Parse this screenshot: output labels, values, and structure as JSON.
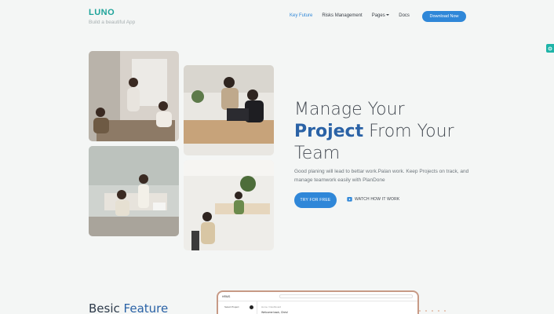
{
  "brand": {
    "name": "LUNO",
    "tagline": "Build a beautiful App"
  },
  "nav": {
    "items": [
      {
        "label": "Key Future",
        "active": true
      },
      {
        "label": "Risks Management",
        "active": false
      },
      {
        "label": "Pages",
        "active": false,
        "dropdown": true
      },
      {
        "label": "Docs",
        "active": false
      }
    ],
    "download_label": "Download Now"
  },
  "hero": {
    "headline_line1": "Manage Your",
    "headline_highlight": "Project",
    "headline_line2_rest": " From Your",
    "headline_line3": "Team",
    "subtext": "Good planing will lead to bettar work.Palan work. Keep Projects on track, and manage teamwork easily with PlanDone",
    "try_label": "TRY FOR FREE",
    "watch_label": "WATCH HOW IT WORK"
  },
  "features": {
    "title_start": "Besic ",
    "title_highlight": "Feature"
  },
  "preview": {
    "logo": "HRMS",
    "sidebar_item": "Select Project",
    "breadcrumb": "Home / Dashboard",
    "title": "Welcome back, Chris!"
  },
  "colors": {
    "accent": "#2f87d8",
    "brand": "#1ea39a",
    "heading_highlight": "#2a62a6"
  },
  "icons": [
    "gear-icon",
    "play-icon",
    "caret-down-icon"
  ]
}
